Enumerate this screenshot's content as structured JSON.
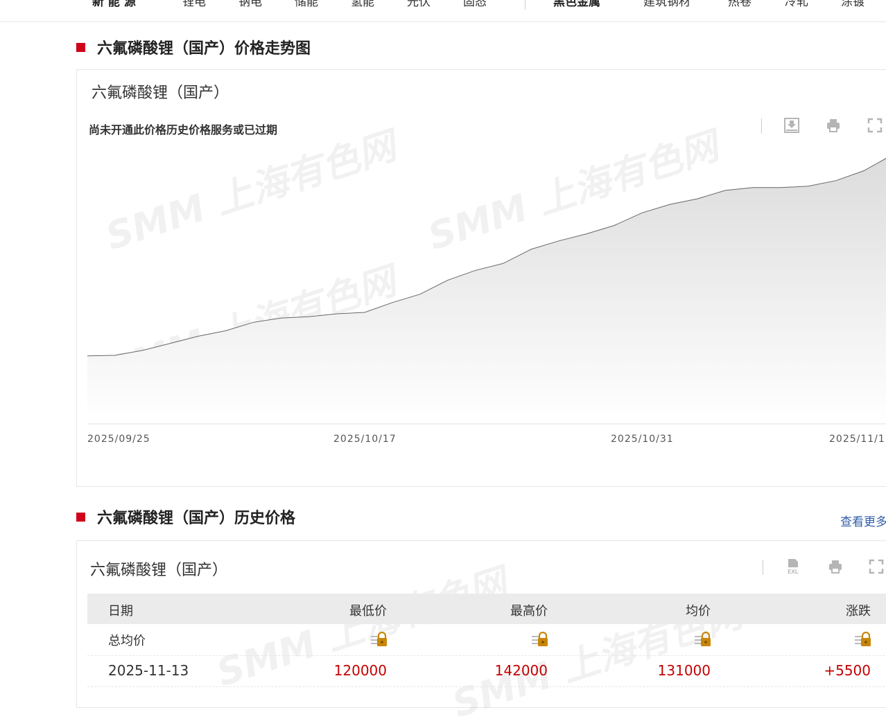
{
  "nav": {
    "items": [
      "新 能 源",
      "锂电",
      "钠电",
      "储能",
      "氢能",
      "光伏",
      "固态",
      "黑色金属",
      "建筑钢材",
      "热卷",
      "冷轧",
      "涂镀"
    ]
  },
  "chart_section": {
    "title": "六氟磷酸锂（国产）价格走势图",
    "panel_title": "六氟磷酸锂（国产）",
    "notice": "尚未开通此价格历史价格服务或已过期",
    "toolbar_icons": [
      "download-image-icon",
      "print-icon",
      "fullscreen-icon"
    ],
    "watermark": "SMM 上海有色网"
  },
  "chart_data": {
    "type": "area",
    "x_tick_labels": [
      "2025/09/25",
      "2025/10/17",
      "2025/10/31",
      "2025/11/1"
    ],
    "x": [
      "2025/09/25",
      "2025/09/26",
      "2025/09/29",
      "2025/09/30",
      "2025/10/09",
      "2025/10/10",
      "2025/10/13",
      "2025/10/14",
      "2025/10/15",
      "2025/10/16",
      "2025/10/17",
      "2025/10/20",
      "2025/10/21",
      "2025/10/22",
      "2025/10/23",
      "2025/10/24",
      "2025/10/27",
      "2025/10/28",
      "2025/10/29",
      "2025/10/30",
      "2025/10/31",
      "2025/11/03",
      "2025/11/04",
      "2025/11/05",
      "2025/11/06",
      "2025/11/07",
      "2025/11/10",
      "2025/11/11",
      "2025/11/12",
      "2025/11/13"
    ],
    "values": [
      64000,
      64200,
      66000,
      68500,
      71000,
      73000,
      76000,
      77500,
      78000,
      79000,
      79500,
      83000,
      86000,
      91000,
      94500,
      97000,
      102000,
      105000,
      107500,
      110500,
      115000,
      118000,
      120000,
      123000,
      124000,
      124000,
      124500,
      126500,
      130000,
      135500
    ],
    "ylim": [
      40000,
      140000
    ],
    "grid": false,
    "legend": "none",
    "line_color": "#666666",
    "fill_color_top": "#dcdcdc",
    "fill_color_bottom": "#ffffff"
  },
  "history_section": {
    "title": "六氟磷酸锂（国产）历史价格",
    "more_link": "查看更多",
    "panel_title": "六氟磷酸锂（国产）",
    "toolbar_icons": [
      "export-excel-icon",
      "print-icon",
      "fullscreen-icon"
    ],
    "excel_label": "EXL",
    "columns": [
      "日期",
      "最低价",
      "最高价",
      "均价",
      "涨跌"
    ],
    "rows": [
      {
        "date": "总均价",
        "low": "",
        "high": "",
        "avg": "",
        "change": "",
        "locked": true
      },
      {
        "date": "2025-11-13",
        "low": "120000",
        "high": "142000",
        "avg": "131000",
        "change": "+5500",
        "locked": false
      }
    ]
  },
  "colors": {
    "accent_red": "#d0021b",
    "price_red": "#c40000",
    "link_blue": "#2f5ea8",
    "lock_gold": "#c8860a"
  }
}
